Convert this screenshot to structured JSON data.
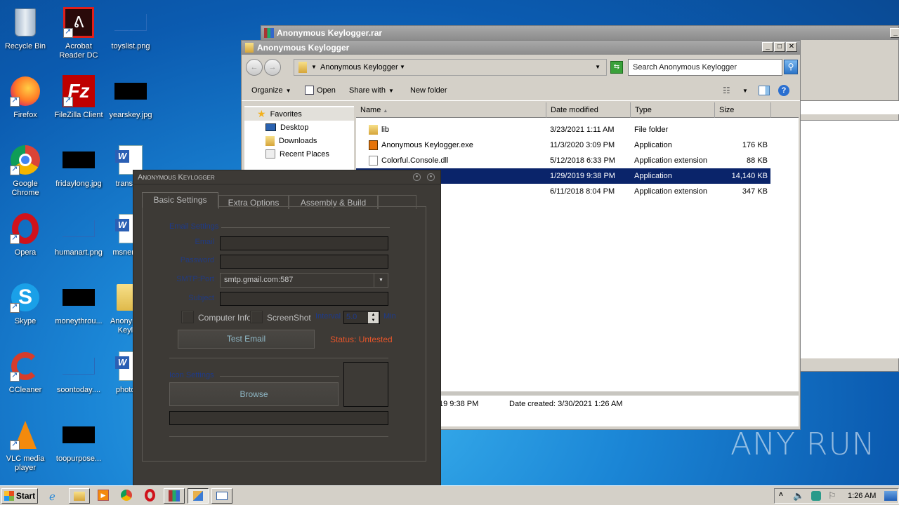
{
  "desktop": {
    "icons": [
      {
        "label": "Recycle Bin",
        "icon": "recycle-bin-icon"
      },
      {
        "label": "Acrobat Reader DC",
        "icon": "acrobat-icon"
      },
      {
        "label": "toyslist.png",
        "icon": "image-file-icon"
      },
      {
        "label": "Firefox",
        "icon": "firefox-icon"
      },
      {
        "label": "FileZilla Client",
        "icon": "filezilla-icon"
      },
      {
        "label": "yearskey.jpg",
        "icon": "image-file-icon"
      },
      {
        "label": "Google Chrome",
        "icon": "chrome-icon"
      },
      {
        "label": "fridaylong.jpg",
        "icon": "image-file-icon"
      },
      {
        "label": "transfe...",
        "icon": "word-doc-icon"
      },
      {
        "label": "Opera",
        "icon": "opera-icon"
      },
      {
        "label": "humanart.png",
        "icon": "image-file-icon"
      },
      {
        "label": "msnemp...",
        "icon": "word-doc-icon"
      },
      {
        "label": "Skype",
        "icon": "skype-icon"
      },
      {
        "label": "moneythrou...",
        "icon": "image-file-icon"
      },
      {
        "label": "Anonymous Keylo...",
        "icon": "folder-icon"
      },
      {
        "label": "CCleaner",
        "icon": "ccleaner-icon"
      },
      {
        "label": "soontoday....",
        "icon": "image-file-icon"
      },
      {
        "label": "photos...",
        "icon": "word-doc-icon"
      },
      {
        "label": "VLC media player",
        "icon": "vlc-icon"
      },
      {
        "label": "toopurpose...",
        "icon": "image-file-icon"
      }
    ]
  },
  "rar_window": {
    "title": "Anonymous Keylogger.rar"
  },
  "explorer": {
    "title": "Anonymous Keylogger",
    "address": "Anonymous Keylogger",
    "search_placeholder": "Search Anonymous Keylogger",
    "toolbar": {
      "organize": "Organize",
      "open": "Open",
      "share_with": "Share with",
      "new_folder": "New folder"
    },
    "nav": {
      "favorites": "Favorites",
      "items": [
        "Desktop",
        "Downloads",
        "Recent Places"
      ]
    },
    "columns": [
      "Name",
      "Date modified",
      "Type",
      "Size"
    ],
    "files": [
      {
        "name": "lib",
        "date": "3/23/2021 1:11 AM",
        "type": "File folder",
        "size": "",
        "icon": "folder-icon"
      },
      {
        "name": "Anonymous Keylogger.exe",
        "date": "11/3/2020 3:09 PM",
        "type": "Application",
        "size": "176 KB",
        "icon": "exe-icon"
      },
      {
        "name": "Colorful.Console.dll",
        "date": "5/12/2018 6:33 PM",
        "type": "Application extension",
        "size": "88 KB",
        "icon": "dll-icon"
      },
      {
        "name": "",
        "date": "1/29/2019 9:38 PM",
        "type": "Application",
        "size": "14,140 KB",
        "icon": "exe-icon",
        "selected": true
      },
      {
        "name": "",
        "date": "6/11/2018 8:04 PM",
        "type": "Application extension",
        "size": "347 KB",
        "icon": "dll-icon"
      }
    ],
    "details": {
      "modified_partial": "19 9:38 PM",
      "date_created": "Date created: 3/30/2021 1:26 AM"
    }
  },
  "keylogger": {
    "title": "Anonymous Keylogger",
    "tabs": [
      "Basic Settings",
      "Extra Options",
      "Assembly & Build"
    ],
    "email_section": "Email Settings",
    "labels": {
      "email": "Email",
      "password": "Password",
      "smtp": "SMTP:Port",
      "subject": "Subject",
      "interval": "Interval",
      "min": "Min"
    },
    "values": {
      "email": "",
      "password": "",
      "smtp": "smtp.gmail.com:587",
      "subject": "",
      "interval": "5.0"
    },
    "checkboxes": {
      "computer_info": "Computer Info",
      "screenshot": "ScreenShot"
    },
    "test_email": "Test Email",
    "status": "Status: Untested",
    "status_color": "#e8552a",
    "icon_section": "Icon Settings",
    "browse": "Browse",
    "icon_path": ""
  },
  "taskbar": {
    "start": "Start",
    "apps": [
      "internet-explorer-icon",
      "explorer-icon",
      "media-player-icon",
      "chrome-icon",
      "opera-icon",
      "winrar-icon",
      "explorer-window-icon",
      "keylogger-window-icon"
    ],
    "clock": "1:26 AM"
  },
  "watermark": "ANY RUN"
}
